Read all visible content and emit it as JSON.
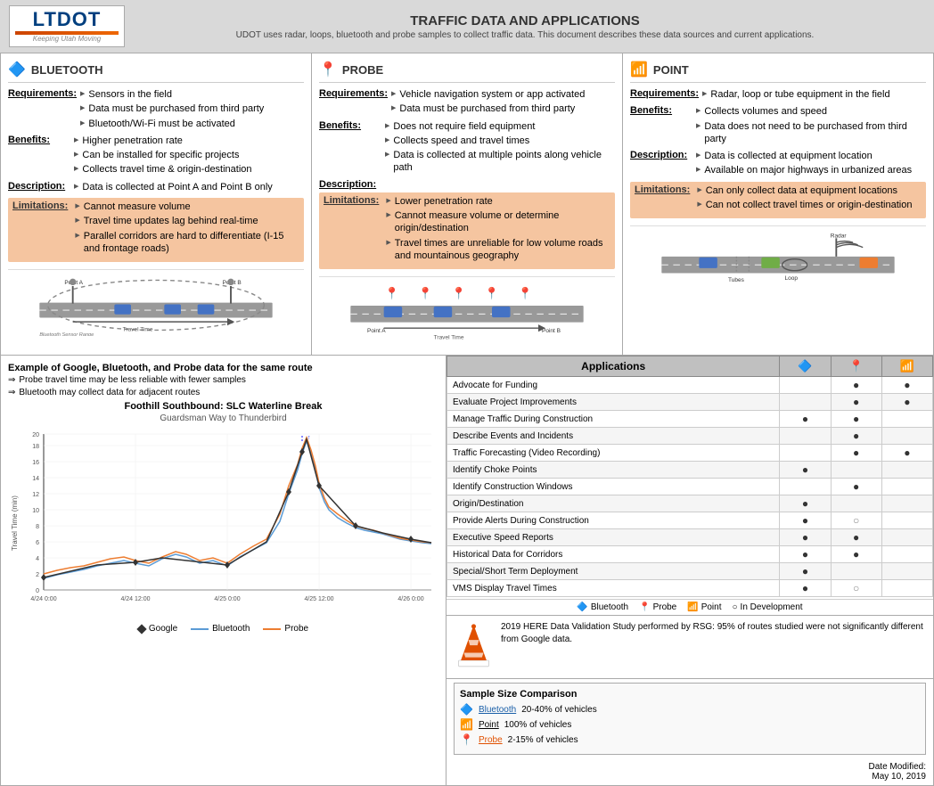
{
  "header": {
    "title": "TRAFFIC DATA AND APPLICATIONS",
    "subtitle": "UDOT uses radar, loops, bluetooth and probe samples to collect traffic data. This document describes these data sources and current applications.",
    "logo_main": "LTDOT",
    "logo_sub": "Keeping Utah Moving"
  },
  "panels": [
    {
      "id": "bluetooth",
      "icon": "🔵",
      "title": "BLUETOOTH",
      "requirements": [
        "Sensors in the field",
        "Data must be purchased from third party",
        "Bluetooth/Wi-Fi must be activated"
      ],
      "benefits": [
        "Higher penetration rate",
        "Can be installed for specific projects",
        "Collects travel time & origin-destination"
      ],
      "description": [
        "Data is collected at Point A and Point B only"
      ],
      "limitations": [
        "Cannot measure volume",
        "Travel time updates lag behind real-time",
        "Parallel corridors are hard to differentiate (I-15 and frontage roads)"
      ]
    },
    {
      "id": "probe",
      "icon": "📍",
      "title": "PROBE",
      "requirements": [
        "Vehicle navigation system or app activated",
        "Data must be purchased from third party"
      ],
      "benefits": [
        "Does not require field equipment",
        "Collects speed and travel times",
        "Data is collected at multiple points along vehicle path"
      ],
      "description": [],
      "limitations": [
        "Lower penetration rate",
        "Cannot measure volume or determine origin/destination",
        "Travel times are unreliable for low volume roads and mountainous geography"
      ]
    },
    {
      "id": "point",
      "icon": "📡",
      "title": "POINT",
      "requirements": [
        "Radar, loop or tube equipment in the field"
      ],
      "benefits": [
        "Collects volumes and speed",
        "Data does not need to be purchased from third party"
      ],
      "description": [
        "Data is collected at equipment location",
        "Available on major highways in urbanized areas"
      ],
      "limitations": [
        "Can only collect data at equipment locations",
        "Can not collect travel times or origin-destination"
      ]
    }
  ],
  "bottom": {
    "left_title": "Example of Google, Bluetooth, and Probe data for the same route",
    "note1": "Probe travel time may be less reliable with fewer samples",
    "note2": "Bluetooth may collect data for adjacent routes",
    "chart_title": "Foothill Southbound: SLC Waterline Break",
    "chart_subtitle": "Guardsman Way to Thunderbird",
    "chart_yaxis": "Travel Time (min)",
    "chart_dates": [
      "4/24 0:00",
      "4/24 12:00",
      "4/25 0:00",
      "4/25 12:00",
      "4/26 0:00"
    ],
    "chart_yvals": [
      "0",
      "2",
      "4",
      "6",
      "8",
      "10",
      "12",
      "14",
      "16",
      "18",
      "20"
    ]
  },
  "applications": {
    "header": "Applications",
    "col_bluetooth": "bluetooth",
    "col_probe": "probe",
    "col_point": "point",
    "rows": [
      {
        "name": "Advocate for Funding",
        "bt": "",
        "probe": "•",
        "point": "•"
      },
      {
        "name": "Evaluate Project Improvements",
        "bt": "",
        "probe": "•",
        "point": "•"
      },
      {
        "name": "Manage Traffic During Construction",
        "bt": "•",
        "probe": "•",
        "point": ""
      },
      {
        "name": "Describe Events and Incidents",
        "bt": "",
        "probe": "•",
        "point": ""
      },
      {
        "name": "Traffic Forecasting (Video Recording)",
        "bt": "",
        "probe": "•",
        "point": "•"
      },
      {
        "name": "Identify Choke Points",
        "bt": "•",
        "probe": "",
        "point": ""
      },
      {
        "name": "Identify Construction Windows",
        "bt": "",
        "probe": "•",
        "point": ""
      },
      {
        "name": "Origin/Destination",
        "bt": "•",
        "probe": "",
        "point": ""
      },
      {
        "name": "Provide Alerts During Construction",
        "bt": "•",
        "probe": "○",
        "point": ""
      },
      {
        "name": "Executive Speed Reports",
        "bt": "•",
        "probe": "•",
        "point": ""
      },
      {
        "name": "Historical Data for Corridors",
        "bt": "•",
        "probe": "•",
        "point": ""
      },
      {
        "name": "Special/Short Term Deployment",
        "bt": "•",
        "probe": "",
        "point": ""
      },
      {
        "name": "VMS Display Travel Times",
        "bt": "•",
        "probe": "○",
        "point": ""
      }
    ],
    "legend": [
      "Bluetooth",
      "Probe",
      "Point",
      "In Development"
    ]
  },
  "here_study": {
    "text": "2019 HERE Data Validation Study performed by RSG: 95% of routes studied were not significantly different from Google data."
  },
  "sample_size": {
    "title": "Sample Size Comparison",
    "items": [
      {
        "label": "Bluetooth",
        "value": "20-40% of vehicles",
        "icon": "bt"
      },
      {
        "label": "Point",
        "value": "100% of vehicles",
        "icon": "pt"
      },
      {
        "label": "Probe",
        "value": "2-15% of vehicles",
        "icon": "pr"
      }
    ]
  },
  "date_modified": {
    "label": "Date Modified:",
    "value": "May 10, 2019"
  }
}
